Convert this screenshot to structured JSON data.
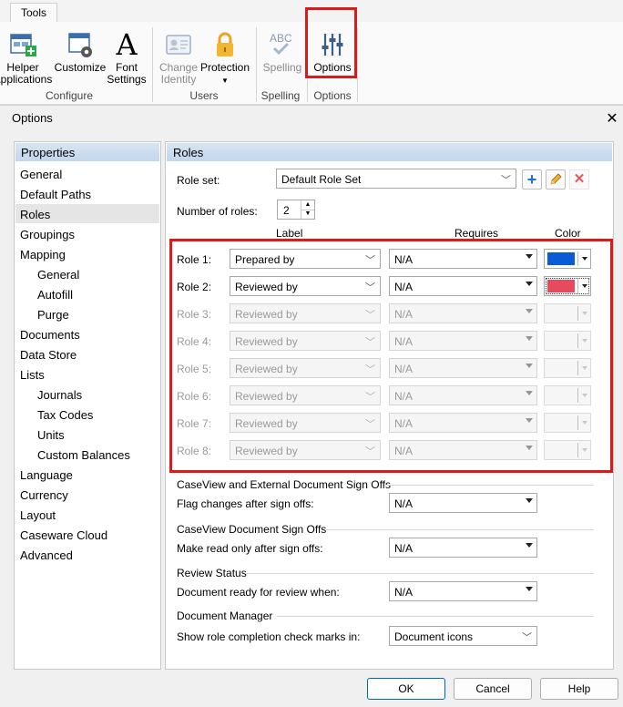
{
  "ribbon": {
    "tab": "Tools",
    "buttons": {
      "helper": [
        "Helper",
        "Applications"
      ],
      "customize": "Customize",
      "font": [
        "Font",
        "Settings"
      ],
      "change_identity": [
        "Change",
        "Identity"
      ],
      "protection": "Protection",
      "spelling": "Spelling",
      "options": "Options"
    },
    "groups": {
      "configure": "Configure",
      "users": "Users",
      "spelling": "Spelling",
      "options": "Options"
    },
    "spelling_icon_text": "ABC",
    "font_icon_text": "A"
  },
  "dialog": {
    "title": "Options",
    "close_glyph": "✕",
    "left": {
      "header": "Properties",
      "items": [
        "General",
        "Default Paths",
        "Roles",
        "Groupings",
        "Mapping",
        "General",
        "Autofill",
        "Purge",
        "Documents",
        "Data Store",
        "Lists",
        "Journals",
        "Tax Codes",
        "Units",
        "Custom Balances",
        "Language",
        "Currency",
        "Layout",
        "Caseware Cloud",
        "Advanced"
      ],
      "selected_index": 2
    },
    "right": {
      "header": "Roles",
      "role_set_label": "Role set:",
      "role_set_value": "Default Role Set",
      "num_roles_label": "Number of roles:",
      "num_roles_value": "2",
      "col_label": "Label",
      "col_requires": "Requires",
      "col_color": "Color",
      "roles": [
        {
          "name": "Role 1:",
          "label": "Prepared by",
          "requires": "N/A",
          "color": "#0a5bd6",
          "enabled": true
        },
        {
          "name": "Role 2:",
          "label": "Reviewed by",
          "requires": "N/A",
          "color": "#e8495c",
          "enabled": true
        },
        {
          "name": "Role 3:",
          "label": "Reviewed by",
          "requires": "N/A",
          "color": "",
          "enabled": false
        },
        {
          "name": "Role 4:",
          "label": "Reviewed by",
          "requires": "N/A",
          "color": "",
          "enabled": false
        },
        {
          "name": "Role 5:",
          "label": "Reviewed by",
          "requires": "N/A",
          "color": "",
          "enabled": false
        },
        {
          "name": "Role 6:",
          "label": "Reviewed by",
          "requires": "N/A",
          "color": "",
          "enabled": false
        },
        {
          "name": "Role 7:",
          "label": "Reviewed by",
          "requires": "N/A",
          "color": "",
          "enabled": false
        },
        {
          "name": "Role 8:",
          "label": "Reviewed by",
          "requires": "N/A",
          "color": "",
          "enabled": false
        }
      ],
      "sections": [
        {
          "title": "CaseView and External Document Sign Offs",
          "label": "Flag changes after sign offs:",
          "value": "N/A"
        },
        {
          "title": "CaseView Document Sign Offs",
          "label": "Make read only after sign offs:",
          "value": "N/A"
        },
        {
          "title": "Review Status",
          "label": "Document ready for review when:",
          "value": "N/A"
        },
        {
          "title": "Document Manager",
          "label": "Show role completion check marks in:",
          "value": "Document icons"
        }
      ]
    },
    "buttons": {
      "ok": "OK",
      "cancel": "Cancel",
      "help": "Help"
    }
  }
}
